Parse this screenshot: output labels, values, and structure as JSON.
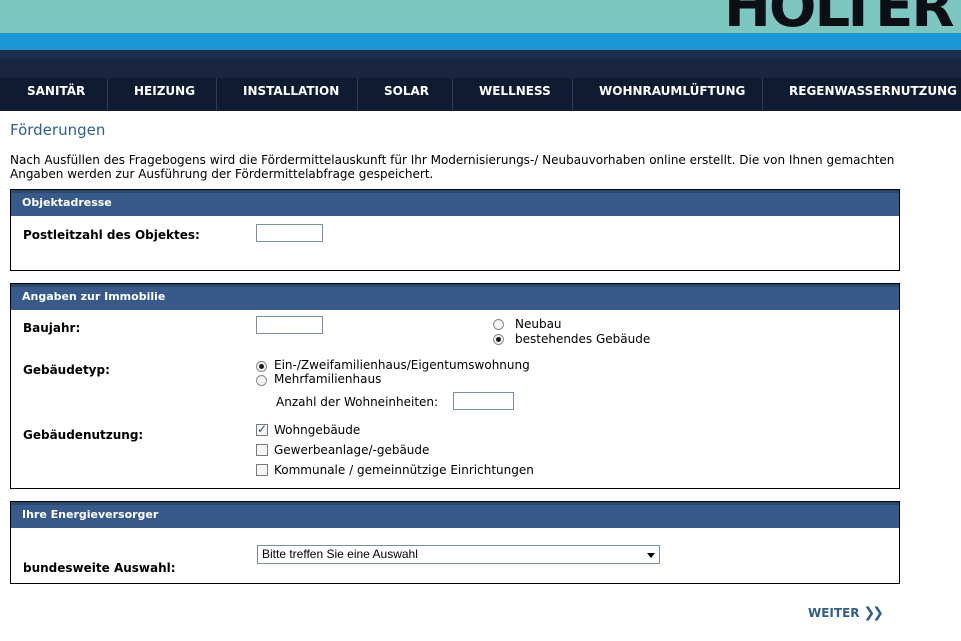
{
  "brand": {
    "logo_text": "HOLTER"
  },
  "nav": {
    "items": [
      "SANITÄR",
      "HEIZUNG",
      "INSTALLATION",
      "SOLAR",
      "WELLNESS",
      "WOHNRAUMLÜFTUNG",
      "REGENWASSERNUTZUNG"
    ]
  },
  "page": {
    "title": "Förderungen",
    "intro": "Nach Ausfüllen des Fragebogens wird die Fördermittelauskunft für Ihr Modernisierungs-/ Neubauvorhaben online erstellt. Die von Ihnen gemachten Angaben werden zur Ausführung der Fördermittelabfrage gespeichert."
  },
  "objektadresse": {
    "heading": "Objektadresse",
    "plz_label": "Postleitzahl des Objektes:",
    "plz_value": ""
  },
  "immobilie": {
    "heading": "Angaben zur Immobilie",
    "baujahr_label": "Baujahr:",
    "baujahr_value": "",
    "neubau_label": "Neubau",
    "bestehend_label": "bestehendes Gebäude",
    "gebaeudetyp_label": "Gebäudetyp:",
    "typ_ein_label": "Ein-/Zweifamilienhaus/Eigentumswohnung",
    "typ_mehr_label": "Mehrfamilienhaus",
    "wohneinheiten_label": "Anzahl der Wohneinheiten:",
    "wohneinheiten_value": "",
    "nutzung_label": "Gebäudenutzung:",
    "nutzung_wohn_label": "Wohngebäude",
    "nutzung_gewerbe_label": "Gewerbeanlage/-gebäude",
    "nutzung_kommunal_label": "Kommunale / gemeinnützige Einrichtungen"
  },
  "energie": {
    "heading": "Ihre Energieversorger",
    "auswahl_label": "bundesweite Auswahl:",
    "auswahl_selected": "Bitte treffen Sie eine Auswahl"
  },
  "footer": {
    "next_label": "WEITER"
  },
  "colors": {
    "accent": "#385a8a",
    "teal": "#7cc8c0",
    "blue": "#1a97d5",
    "nav": "#0f1b30",
    "title": "#2f5f8d"
  }
}
